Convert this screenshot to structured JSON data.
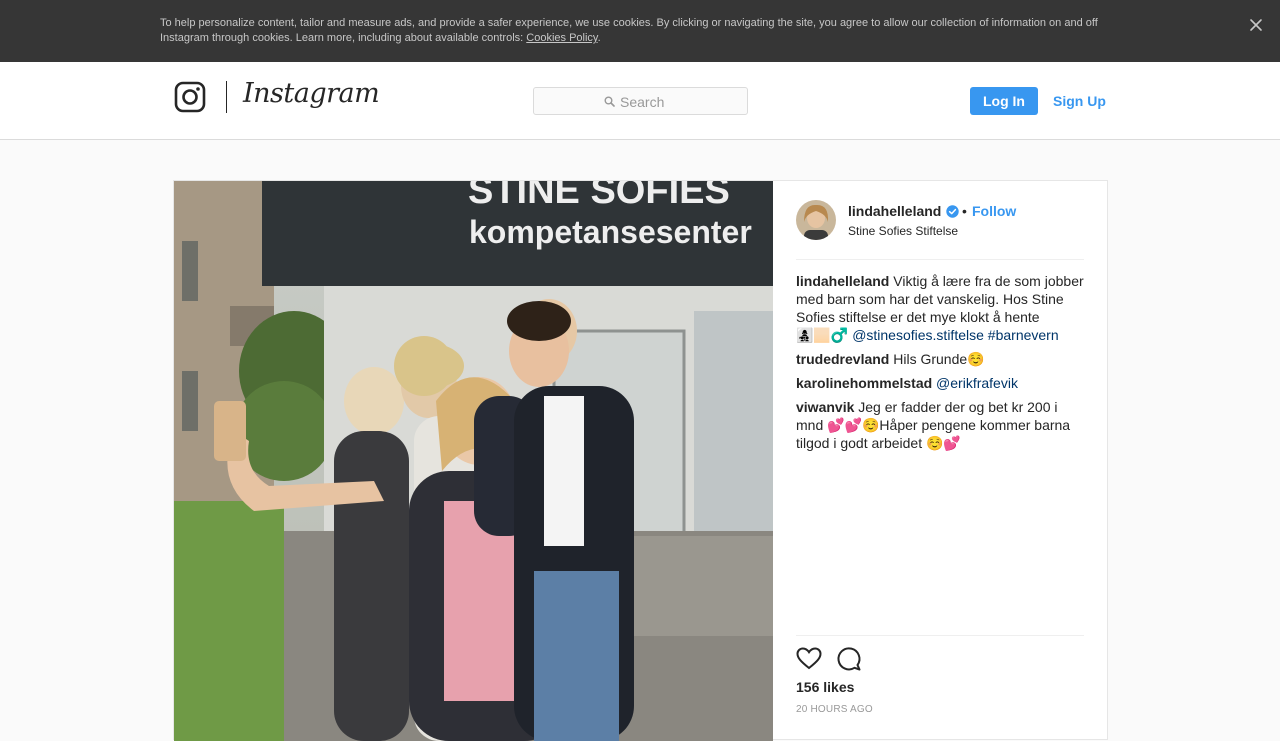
{
  "cookie_banner": {
    "text": "To help personalize content, tailor and measure ads, and provide a safer experience, we use cookies. By clicking or navigating the site, you agree to allow our collection of information on and off Instagram through cookies. Learn more, including about available controls: ",
    "link": "Cookies Policy",
    "end": ".",
    "close_icon": "close-icon"
  },
  "header": {
    "logo_icon": "instagram-camera-icon",
    "wordmark": "Instagram",
    "search_placeholder": "Search",
    "search_icon": "search-icon",
    "login_label": "Log In",
    "signup_label": "Sign Up",
    "accent_color": "#3897f0"
  },
  "post": {
    "owner": "lindahelleland",
    "verified_icon": "verified-badge-icon",
    "follow_label": "Follow",
    "location": "Stine Sofies Stiftelse",
    "photo_sign_line1": "STINE SOFIES",
    "photo_sign_line2": "kompetansesenter",
    "caption": {
      "user": "lindahelleland",
      "text": "Viktig å lære fra de som jobber med barn som har det vanskelig. Hos Stine Sofies stiftelse er det mye klokt å hente 👩‍👧‍👦🏻‍♂️ ",
      "mention": "@stinesofies.stiftelse",
      "hashtag": "#barnevern"
    },
    "comments": [
      {
        "user": "trudedrevland",
        "text": "Hils Grunde☺️"
      },
      {
        "user": "karolinehommelstad",
        "text": "",
        "mention": "@erikfrafevik"
      },
      {
        "user": "viwanvik",
        "text": "Jeg er fadder der og bet kr 200 i mnd 💕💕☺️Håper pengene kommer barna tilgod i godt arbeidet ☺️💕"
      }
    ],
    "like_icon": "heart-icon",
    "comment_icon": "comment-bubble-icon",
    "likes": "156 likes",
    "time": "20 HOURS AGO"
  }
}
